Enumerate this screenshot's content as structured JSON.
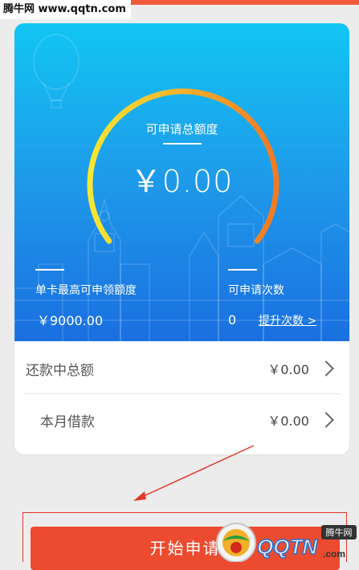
{
  "watermark": {
    "site": "腾牛网 www.qqtn.com"
  },
  "hero": {
    "gauge_label": "可申请总额度",
    "gauge_value": "￥0.00",
    "left_stat": {
      "label": "单卡最高可申领额度",
      "value": "￥9000.00"
    },
    "right_stat": {
      "label": "可申请次数",
      "value": "0",
      "link": "提升次数 >"
    }
  },
  "rows": [
    {
      "label": "还款中总额",
      "value": "￥0.00"
    },
    {
      "label": "本月借款",
      "value": "￥0.00"
    }
  ],
  "apply_button": {
    "label": "开始申请"
  },
  "logo": {
    "text": "QQTN",
    "domain": ".com",
    "badge": "腾牛网"
  },
  "colors": {
    "hero_top": "#12c6f3",
    "hero_bottom": "#1a6fe0",
    "gauge_start": "#f6e733",
    "gauge_end": "#f07a23",
    "button": "#ec4b2f",
    "annotation": "#e23a2a"
  }
}
